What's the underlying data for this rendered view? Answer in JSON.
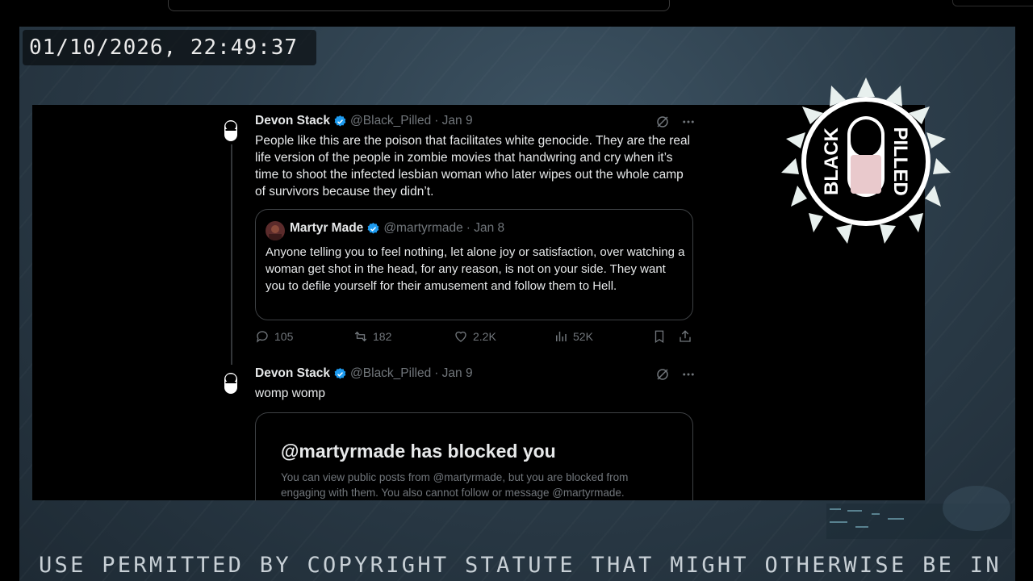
{
  "overlay": {
    "timestamp": "01/10/2026, 22:49:37",
    "scrolling_text": "USE PERMITTED BY COPYRIGHT STATUTE THAT MIGHT OTHERWISE BE IN",
    "logo_text": "BLACK PILLED"
  },
  "thread": {
    "tweet1": {
      "name": "Devon Stack",
      "handle": "@Black_Pilled",
      "date": "· Jan 9",
      "text": "People like this are the poison that facilitates white genocide. They are the real life version of the people in zombie movies that handwring and cry when it’s time to shoot the infected lesbian woman who later wipes out the whole camp of survivors because they didn’t.",
      "quote": {
        "name": "Martyr Made",
        "handle": "@martyrmade",
        "date": "· Jan 8",
        "text": "Anyone telling you to feel nothing, let alone joy or satisfaction, over watching a woman get shot in the head, for any reason, is not on your side. They want you to defile yourself for their amusement and follow them to Hell."
      },
      "replies": "105",
      "reposts": "182",
      "likes": "2.2K",
      "views": "52K"
    },
    "tweet2": {
      "name": "Devon Stack",
      "handle": "@Black_Pilled",
      "date": "· Jan 9",
      "text": "womp womp",
      "blocked_title": "@martyrmade has blocked you",
      "blocked_body": "You can view public posts from @martyrmade, but you are blocked from engaging with them. You also cannot follow or message @martyrmade."
    }
  },
  "colors": {
    "accent_blue": "#1d9bf0",
    "muted_text": "#71767b",
    "primary_text": "#e7e9ea"
  }
}
